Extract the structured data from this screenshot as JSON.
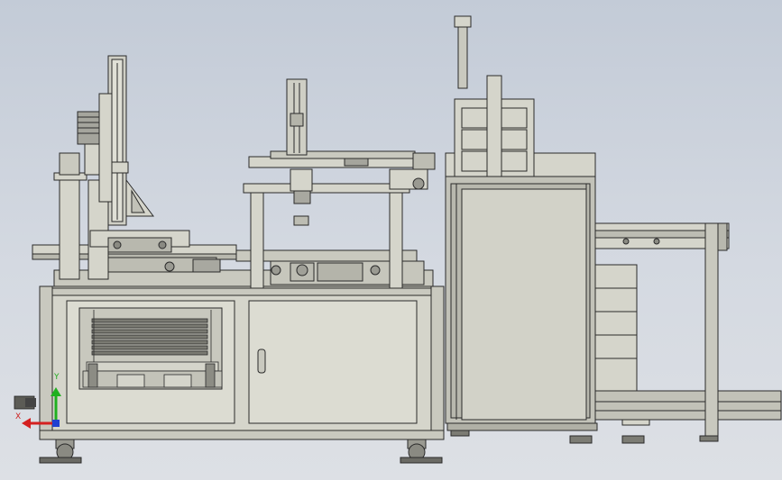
{
  "view": {
    "background_top": "#c3cbd7",
    "background_bottom": "#dde0e5",
    "model_fill": "#d5d5cb",
    "model_line": "#2a2a2a"
  },
  "triad": {
    "x_label": "X",
    "y_label": "Y",
    "x_color": "#d42020",
    "y_color": "#20b020",
    "z_color": "#2040d0"
  },
  "icons": [
    "coordinate-triad-icon"
  ]
}
